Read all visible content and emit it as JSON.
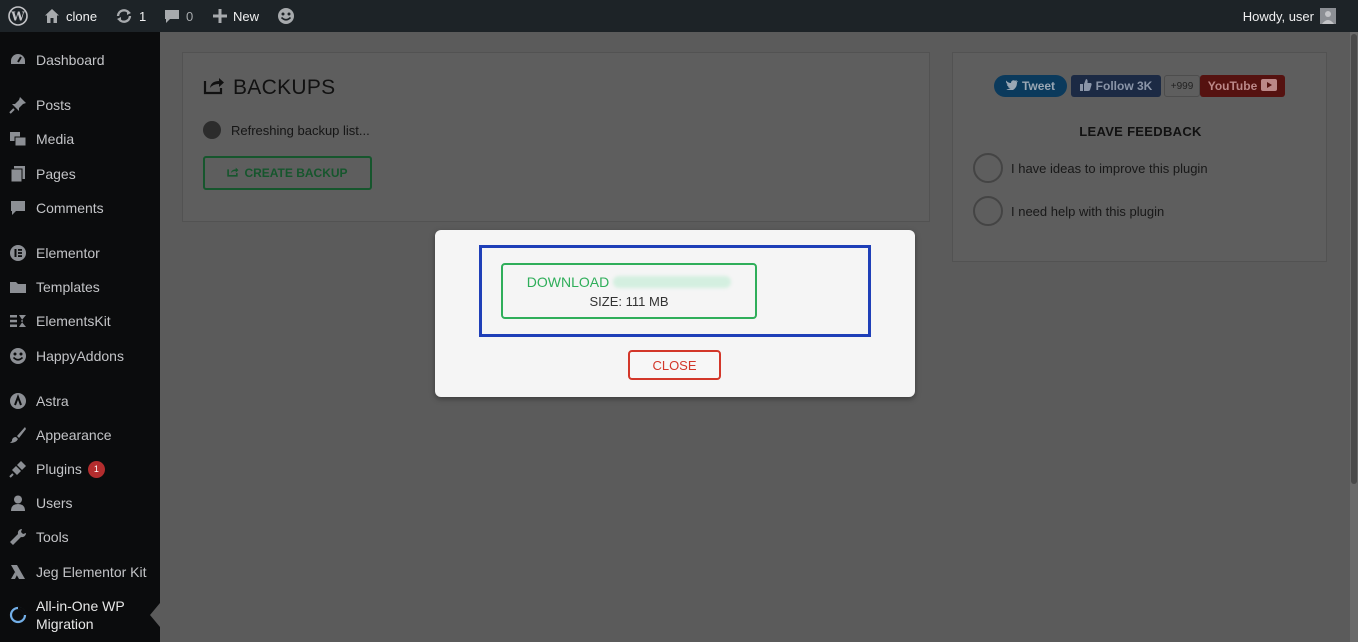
{
  "adminbar": {
    "site_name": "clone",
    "updates_count": "1",
    "comments_count": "0",
    "new_label": "New",
    "howdy": "Howdy, user"
  },
  "sidebar": {
    "items": [
      {
        "label": "Dashboard",
        "icon": "dashboard-icon"
      },
      {
        "label": "Posts",
        "icon": "pin-icon"
      },
      {
        "label": "Media",
        "icon": "media-icon"
      },
      {
        "label": "Pages",
        "icon": "pages-icon"
      },
      {
        "label": "Comments",
        "icon": "comment-icon"
      },
      {
        "label": "Elementor",
        "icon": "elementor-icon"
      },
      {
        "label": "Templates",
        "icon": "folder-icon"
      },
      {
        "label": "ElementsKit",
        "icon": "elementskit-icon"
      },
      {
        "label": "HappyAddons",
        "icon": "happyaddons-icon"
      },
      {
        "label": "Astra",
        "icon": "astra-icon"
      },
      {
        "label": "Appearance",
        "icon": "brush-icon"
      },
      {
        "label": "Plugins",
        "icon": "plug-icon",
        "badge": "1"
      },
      {
        "label": "Users",
        "icon": "user-icon"
      },
      {
        "label": "Tools",
        "icon": "wrench-icon"
      },
      {
        "label": "Jeg Elementor Kit",
        "icon": "jeg-icon"
      },
      {
        "label": "All-in-One WP Migration",
        "icon": "migration-icon"
      }
    ]
  },
  "backups": {
    "title": "BACKUPS",
    "refreshing": "Refreshing backup list...",
    "create_label": "CREATE BACKUP"
  },
  "feedback": {
    "tweet": "Tweet",
    "follow": "Follow 3K",
    "count": "+999",
    "youtube": "YouTube",
    "title": "LEAVE FEEDBACK",
    "options": [
      "I have ideas to improve this plugin",
      "I need help with this plugin"
    ]
  },
  "modal": {
    "download_label": "DOWNLOAD",
    "size_label": "SIZE: 111 MB",
    "close_label": "CLOSE"
  },
  "colors": {
    "accent_green": "#2fae5a",
    "close_red": "#d3372a",
    "highlight_blue": "#1f3fb8"
  }
}
